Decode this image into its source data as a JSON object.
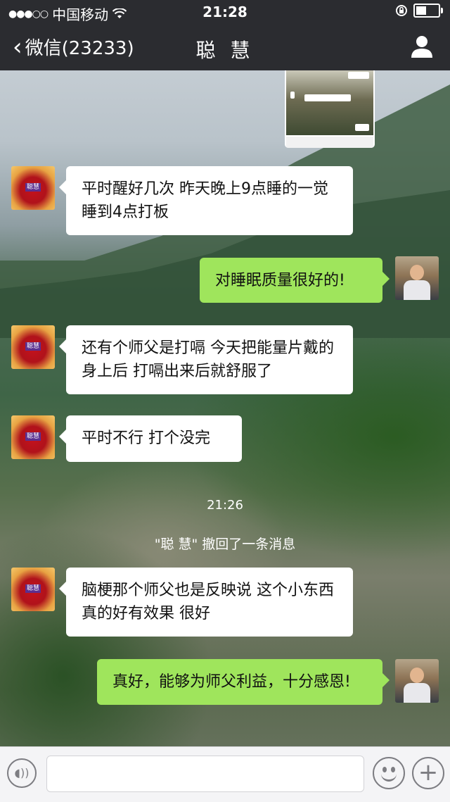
{
  "status_bar": {
    "carrier": "中国移动",
    "time": "21:28",
    "battery_level": 0.55
  },
  "nav": {
    "back_label": "微信(23233)",
    "title": "聪 慧"
  },
  "contact_avatar_text": "聪慧",
  "messages": [
    {
      "from": "contact",
      "text": "平时醒好几次  昨天晚上9点睡的一觉睡到4点打板"
    },
    {
      "from": "me",
      "text": "对睡眠质量很好的!"
    },
    {
      "from": "contact",
      "text": "还有个师父是打嗝  今天把能量片戴的身上后  打嗝出来后就舒服了"
    },
    {
      "from": "contact",
      "text": "平时不行  打个没完"
    },
    {
      "from": "contact",
      "text": "脑梗那个师父也是反映说  这个小东西真的好有效果  很好"
    },
    {
      "from": "me",
      "text": "真好，能够为师父利益，十分感恩!"
    }
  ],
  "system": {
    "time_label": "21:26",
    "recall_notice": "\"聪 慧\" 撤回了一条消息"
  },
  "input": {
    "placeholder": ""
  },
  "icons": {
    "back": "chevron-left-icon",
    "profile": "person-icon",
    "voice": "voice-icon",
    "emoji": "emoji-icon",
    "plus": "plus-icon",
    "wifi": "wifi-icon",
    "lock": "rotation-lock-icon"
  },
  "colors": {
    "outgoing_bubble": "#9fe55c",
    "incoming_bubble": "#ffffff",
    "topbar": "#2b2c30"
  }
}
